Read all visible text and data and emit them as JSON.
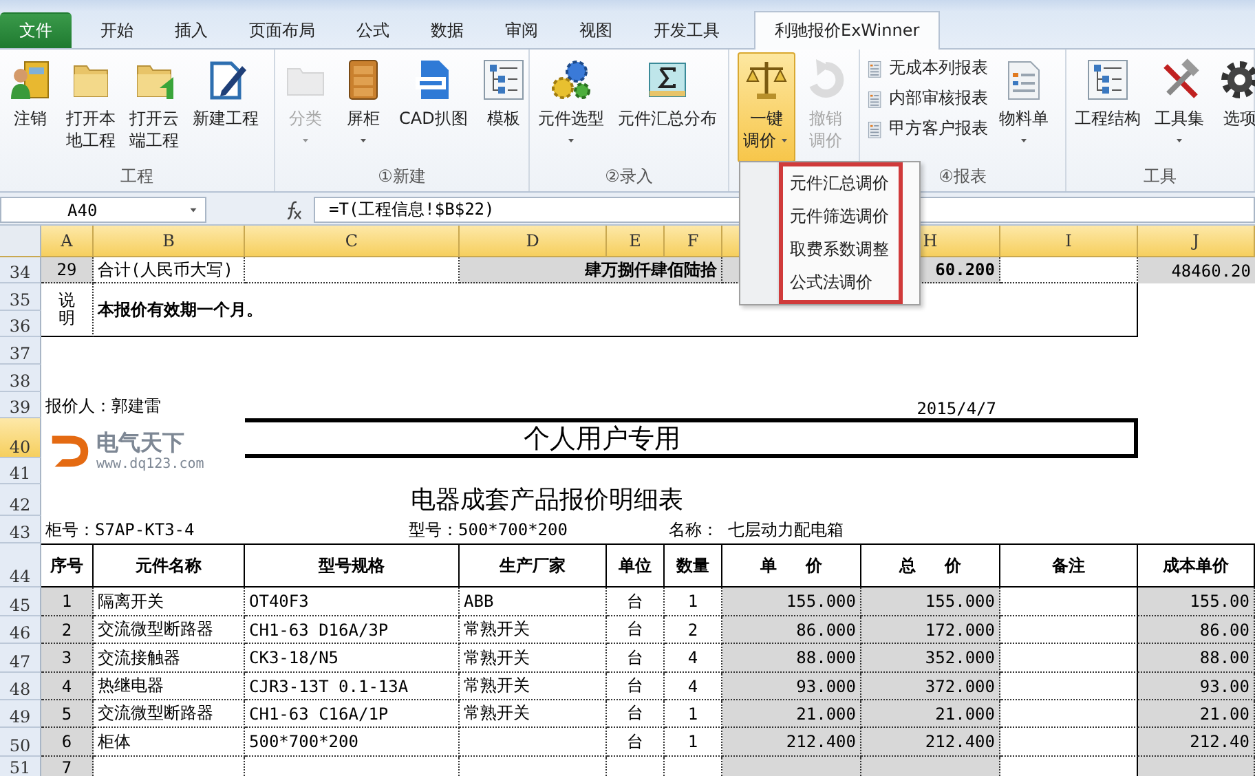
{
  "tabs": [
    {
      "label": "文件",
      "kind": "file",
      "selected": false
    },
    {
      "label": "开始",
      "kind": "normal",
      "selected": false
    },
    {
      "label": "插入",
      "kind": "normal",
      "selected": false
    },
    {
      "label": "页面布局",
      "kind": "normal",
      "selected": false
    },
    {
      "label": "公式",
      "kind": "normal",
      "selected": false
    },
    {
      "label": "数据",
      "kind": "normal",
      "selected": false
    },
    {
      "label": "审阅",
      "kind": "normal",
      "selected": false
    },
    {
      "label": "视图",
      "kind": "normal",
      "selected": false
    },
    {
      "label": "开发工具",
      "kind": "normal",
      "selected": false
    },
    {
      "label": "利驰报价ExWinner",
      "kind": "normal",
      "selected": true
    }
  ],
  "ribbon": {
    "groups": [
      {
        "label": "工程",
        "buttons": [
          {
            "lines": [
              "注销"
            ],
            "kind": "large",
            "dropdown": false,
            "disabled": false,
            "pressed": false
          },
          {
            "lines": [
              "打开本",
              "地工程"
            ],
            "kind": "large",
            "dropdown": false,
            "disabled": false,
            "pressed": false
          },
          {
            "lines": [
              "打开云",
              "端工程"
            ],
            "kind": "large",
            "dropdown": false,
            "disabled": false,
            "pressed": false
          },
          {
            "lines": [
              "新建工程"
            ],
            "kind": "large",
            "dropdown": false,
            "disabled": false,
            "pressed": false
          }
        ]
      },
      {
        "label": "①新建",
        "buttons": [
          {
            "lines": [
              "分类"
            ],
            "kind": "large",
            "dropdown": true,
            "disabled": true,
            "pressed": false
          },
          {
            "lines": [
              "屏柜"
            ],
            "kind": "large",
            "dropdown": true,
            "disabled": false,
            "pressed": false
          },
          {
            "lines": [
              "CAD扒图"
            ],
            "kind": "large",
            "dropdown": false,
            "disabled": false,
            "pressed": false
          },
          {
            "lines": [
              "模板"
            ],
            "kind": "large",
            "dropdown": false,
            "disabled": false,
            "pressed": false
          }
        ]
      },
      {
        "label": "②录入",
        "buttons": [
          {
            "lines": [
              "元件选型"
            ],
            "kind": "large",
            "dropdown": true,
            "disabled": false,
            "pressed": false
          },
          {
            "lines": [
              "元件汇总分布"
            ],
            "kind": "large",
            "dropdown": false,
            "disabled": false,
            "pressed": false
          }
        ]
      },
      {
        "buttons": [
          {
            "lines": [
              "一键",
              "调价"
            ],
            "kind": "large",
            "dropdown": true,
            "disabled": false,
            "pressed": true
          },
          {
            "lines": [
              "撤销",
              "调价"
            ],
            "kind": "large",
            "dropdown": false,
            "disabled": true,
            "pressed": false
          }
        ]
      },
      {
        "label": "④报表",
        "buttons": [
          {
            "lines": [
              "无成本列报表"
            ],
            "kind": "small",
            "dropdown": false,
            "disabled": false,
            "pressed": false
          },
          {
            "lines": [
              "内部审核报表"
            ],
            "kind": "small",
            "dropdown": false,
            "disabled": false,
            "pressed": false
          },
          {
            "lines": [
              "甲方客户报表"
            ],
            "kind": "small",
            "dropdown": false,
            "disabled": false,
            "pressed": false
          },
          {
            "lines": [
              "物料单"
            ],
            "kind": "large",
            "dropdown": true,
            "disabled": false,
            "pressed": false
          }
        ]
      },
      {
        "label": "工具",
        "buttons": [
          {
            "lines": [
              "工程结构"
            ],
            "kind": "large",
            "dropdown": false,
            "disabled": false,
            "pressed": false
          },
          {
            "lines": [
              "工具集"
            ],
            "kind": "large",
            "dropdown": true,
            "disabled": false,
            "pressed": false
          },
          {
            "lines": [
              "选项"
            ],
            "kind": "large",
            "dropdown": false,
            "disabled": false,
            "pressed": false
          }
        ]
      }
    ]
  },
  "dropdown_menu": {
    "highlighted": true,
    "items": [
      {
        "label": "元件汇总调价"
      },
      {
        "label": "元件筛选调价"
      },
      {
        "label": "取费系数调整"
      },
      {
        "label": "公式法调价"
      }
    ]
  },
  "formula_bar": {
    "name_box": "A40",
    "formula": "=T(工程信息!$B$22)"
  },
  "sheet": {
    "column_headers": [
      "A",
      "B",
      "C",
      "D",
      "E",
      "F",
      "H",
      "I",
      "J"
    ],
    "row_headers": [
      {
        "label": "34",
        "selected": false
      },
      {
        "label": "35",
        "selected": false
      },
      {
        "label": "36",
        "selected": false
      },
      {
        "label": "37",
        "selected": false
      },
      {
        "label": "38",
        "selected": false
      },
      {
        "label": "39",
        "selected": false
      },
      {
        "label": "40",
        "selected": true
      },
      {
        "label": "41",
        "selected": false
      },
      {
        "label": "42",
        "selected": false
      },
      {
        "label": "43",
        "selected": false
      },
      {
        "label": "44",
        "selected": false
      },
      {
        "label": "45",
        "selected": false
      },
      {
        "label": "46",
        "selected": false
      },
      {
        "label": "47",
        "selected": false
      },
      {
        "label": "48",
        "selected": false
      },
      {
        "label": "49",
        "selected": false
      },
      {
        "label": "50",
        "selected": false
      },
      {
        "label": "51",
        "selected": false
      }
    ],
    "total_row": {
      "index": "29",
      "label": "合计(人民币大写)",
      "amount_words": "肆万捌仟肆佰陆拾",
      "amount": "60.200",
      "cost_total": "48460.20"
    },
    "note": {
      "label": "说明",
      "text": "本报价有效期一个月。"
    },
    "quoter": "报价人：郭建雷",
    "date": "2015/4/7",
    "logo": {
      "name": "电气天下",
      "url": "www.dq123.com"
    },
    "banner": "个人用户专用",
    "title": "电器成套产品报价明细表",
    "cabinet_no": "柜号：S7AP-KT3-4",
    "model": "型号：500*700*200",
    "product_name": "名称：  七层动力配电箱",
    "table": {
      "columns": [
        "序号",
        "元件名称",
        "型号规格",
        "生产厂家",
        "单位",
        "数量",
        "单     价",
        "总     价",
        "备注",
        "成本单价"
      ],
      "rows": [
        [
          "1",
          "隔离开关",
          "OT40F3",
          "ABB",
          "台",
          "1",
          "155.000",
          "155.000",
          "",
          "155.00"
        ],
        [
          "2",
          "交流微型断路器",
          "CH1-63 D16A/3P",
          "常熟开关",
          "台",
          "2",
          "86.000",
          "172.000",
          "",
          "86.00"
        ],
        [
          "3",
          "交流接触器",
          "CK3-18/N5",
          "常熟开关",
          "台",
          "4",
          "88.000",
          "352.000",
          "",
          "88.00"
        ],
        [
          "4",
          "热继电器",
          "CJR3-13T 0.1-13A",
          "常熟开关",
          "台",
          "4",
          "93.000",
          "372.000",
          "",
          "93.00"
        ],
        [
          "5",
          "交流微型断路器",
          "CH1-63 C16A/1P",
          "常熟开关",
          "台",
          "1",
          "21.000",
          "21.000",
          "",
          "21.00"
        ],
        [
          "6",
          "柜体",
          "500*700*200",
          "",
          "台",
          "1",
          "212.400",
          "212.400",
          "",
          "212.40"
        ],
        [
          "7"
        ]
      ]
    }
  }
}
